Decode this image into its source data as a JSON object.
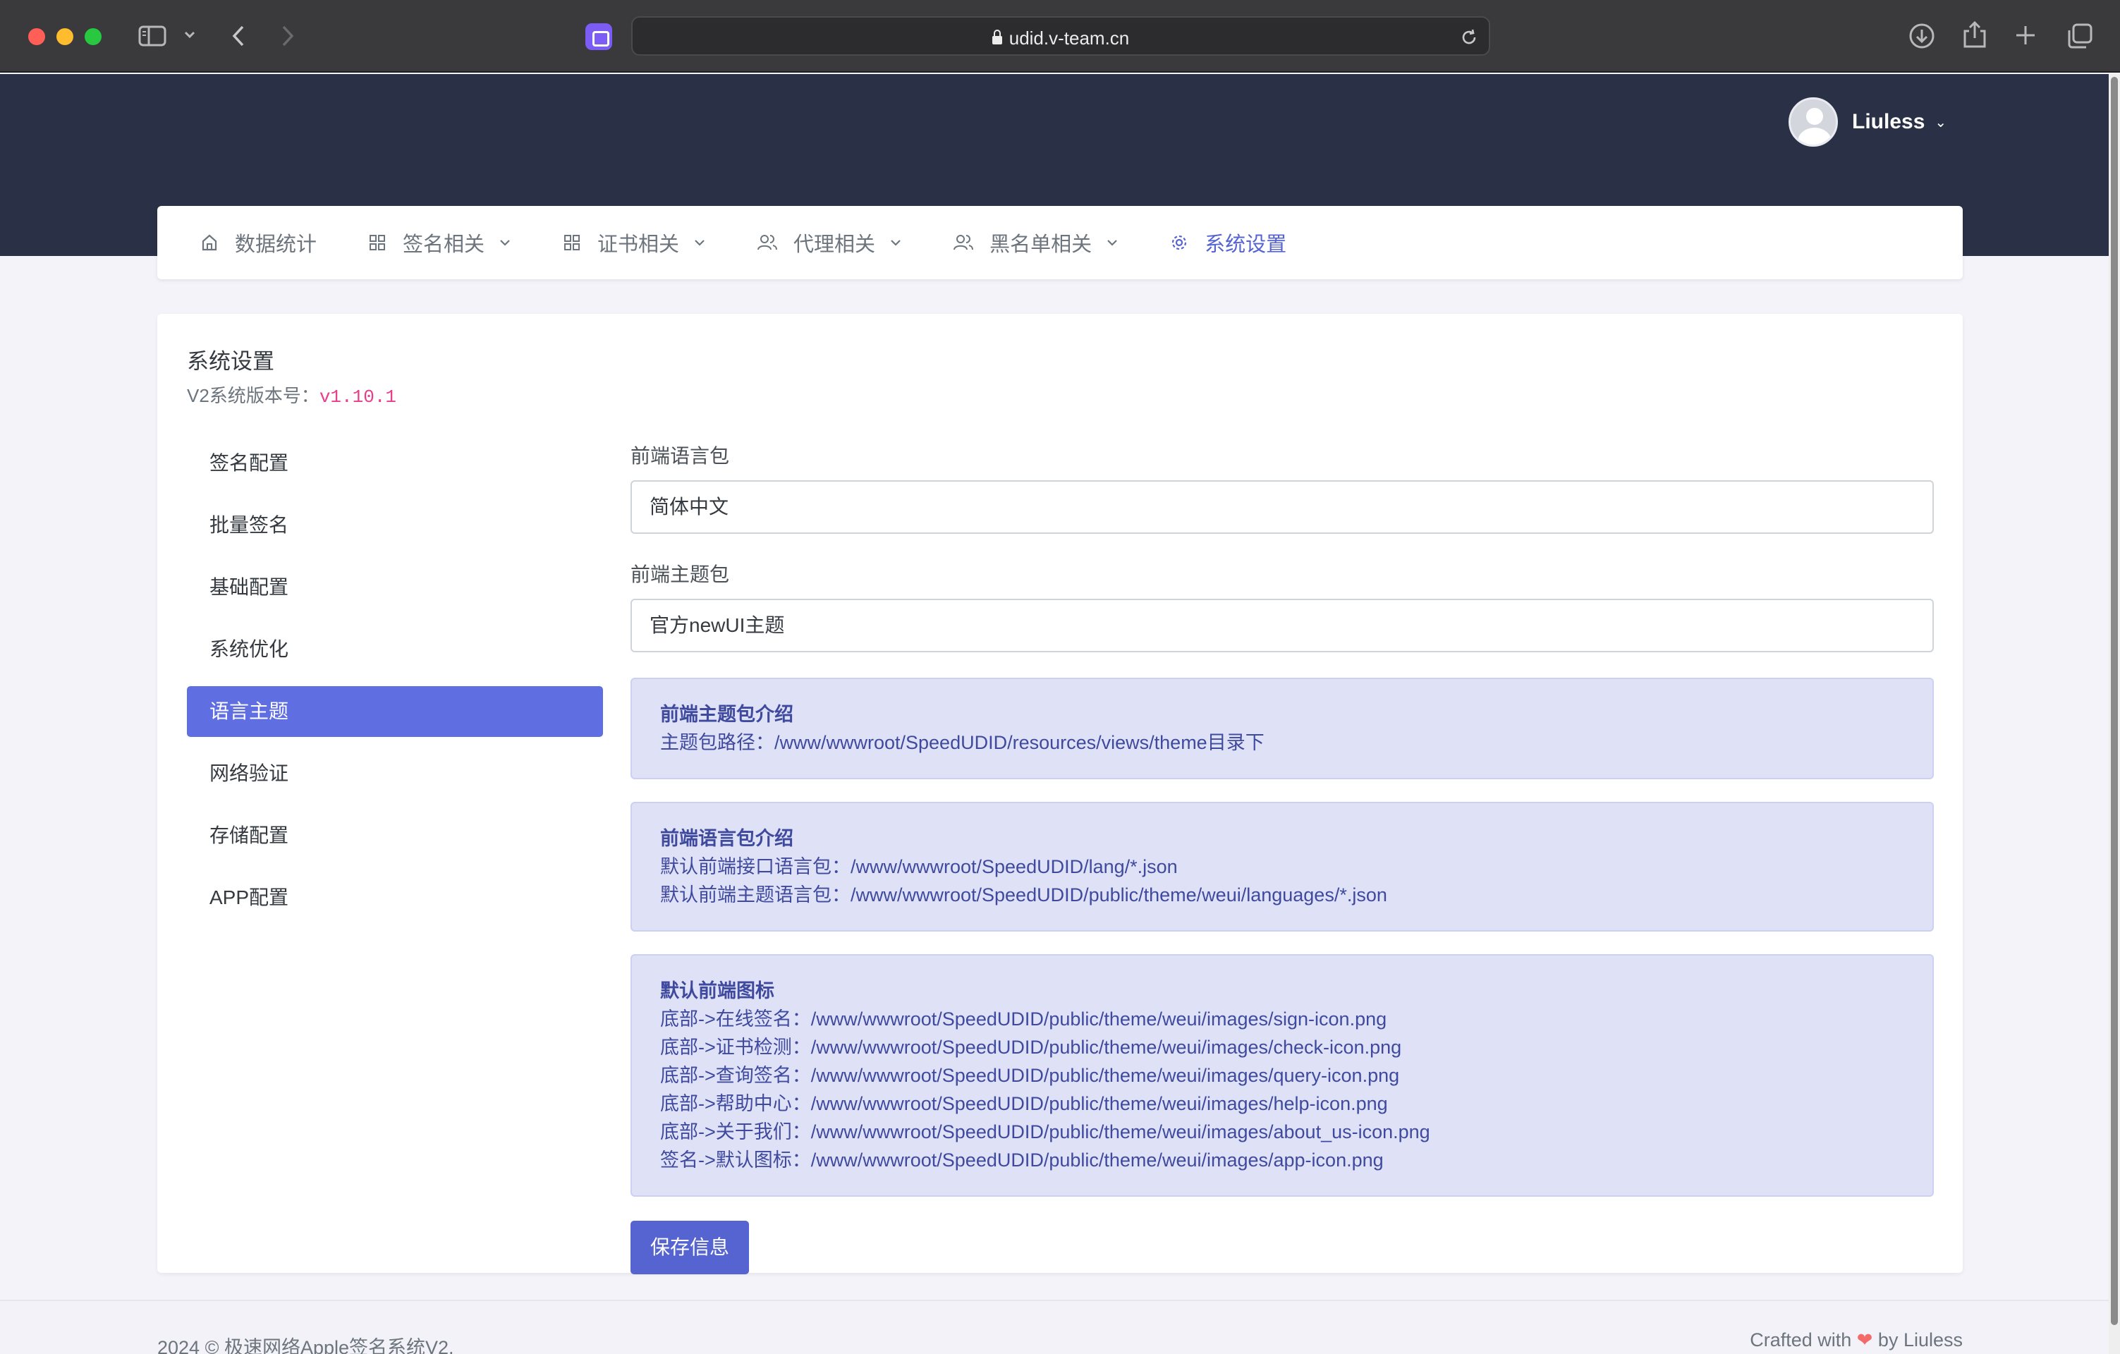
{
  "browser": {
    "url": "udid.v-team.cn"
  },
  "header": {
    "user_name": "Liuless",
    "caret": "⌄"
  },
  "menu": {
    "items": [
      {
        "label": "数据统计",
        "icon": "home-icon"
      },
      {
        "label": "签名相关",
        "icon": "grid-icon"
      },
      {
        "label": "证书相关",
        "icon": "grid-icon"
      },
      {
        "label": "代理相关",
        "icon": "users-icon"
      },
      {
        "label": "黑名单相关",
        "icon": "users-icon"
      },
      {
        "label": "系统设置",
        "icon": "gear-icon"
      }
    ],
    "active_color": "#5664d2"
  },
  "card": {
    "title": "系统设置",
    "version_label": "V2系统版本号：",
    "version_value": "v1.10.1"
  },
  "side_nav": {
    "items": [
      "签名配置",
      "批量签名",
      "基础配置",
      "系统优化",
      "语言主题",
      "网络验证",
      "存储配置",
      "APP配置"
    ],
    "active_index": 4
  },
  "form": {
    "lang_label": "前端语言包",
    "lang_value": "简体中文",
    "theme_label": "前端主题包",
    "theme_value": "官方newUI主题",
    "theme_info": {
      "title": "前端主题包介绍",
      "lines": [
        "主题包路径：/www/wwwroot/SpeedUDID/resources/views/theme目录下"
      ]
    },
    "lang_info": {
      "title": "前端语言包介绍",
      "lines": [
        "默认前端接口语言包：/www/wwwroot/SpeedUDID/lang/*.json",
        "默认前端主题语言包：/www/wwwroot/SpeedUDID/public/theme/weui/languages/*.json"
      ]
    },
    "icon_info": {
      "title": "默认前端图标",
      "lines": [
        "底部->在线签名：/www/wwwroot/SpeedUDID/public/theme/weui/images/sign-icon.png",
        "底部->证书检测：/www/wwwroot/SpeedUDID/public/theme/weui/images/check-icon.png",
        "底部->查询签名：/www/wwwroot/SpeedUDID/public/theme/weui/images/query-icon.png",
        "底部->帮助中心：/www/wwwroot/SpeedUDID/public/theme/weui/images/help-icon.png",
        "底部->关于我们：/www/wwwroot/SpeedUDID/public/theme/weui/images/about_us-icon.png",
        "签名->默认图标：/www/wwwroot/SpeedUDID/public/theme/weui/images/app-icon.png"
      ]
    },
    "save_label": "保存信息"
  },
  "footer": {
    "left": "2024 © 极速网络Apple签名系统V2.",
    "right_prefix": "Crafted with",
    "heart": "❤",
    "right_suffix": "by Liuless"
  }
}
